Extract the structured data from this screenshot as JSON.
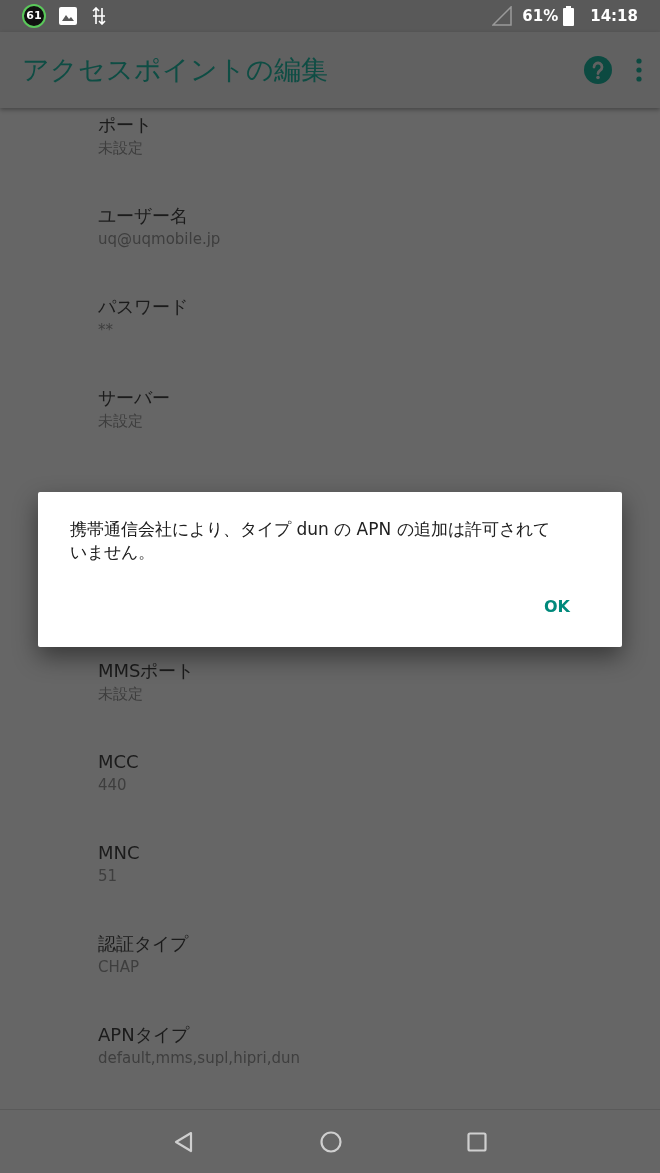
{
  "status_bar": {
    "badge": "61",
    "battery_text": "61%",
    "time": "14:18"
  },
  "app_bar": {
    "title": "アクセスポイントの編集"
  },
  "settings_above": [
    {
      "label": "ポート",
      "value": "未設定"
    },
    {
      "label": "ユーザー名",
      "value": "uq@uqmobile.jp"
    },
    {
      "label": "パスワード",
      "value": "**"
    },
    {
      "label": "サーバー",
      "value": "未設定"
    }
  ],
  "settings_below": [
    {
      "label": "MMSポート",
      "value": "未設定"
    },
    {
      "label": "MCC",
      "value": "440"
    },
    {
      "label": "MNC",
      "value": "51"
    },
    {
      "label": "認証タイプ",
      "value": "CHAP"
    },
    {
      "label": "APNタイプ",
      "value": "default,mms,supl,hipri,dun"
    }
  ],
  "dialog": {
    "message": "携帯通信会社により、タイプ dun の APN の追加は許可されていません。",
    "button": "OK"
  }
}
